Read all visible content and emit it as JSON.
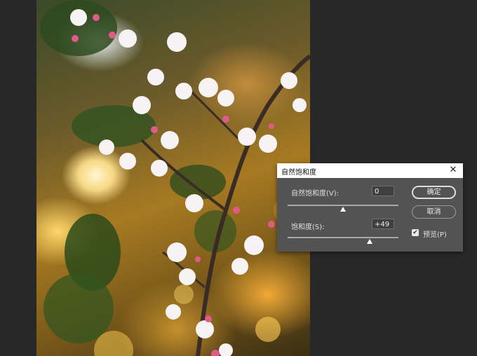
{
  "dialog": {
    "title": "自然饱和度",
    "close_glyph": "✕",
    "vibrance": {
      "label": "自然饱和度(V):",
      "value": "0",
      "slider_fraction": 0.5
    },
    "saturation": {
      "label": "饱和度(S):",
      "value": "+49",
      "slider_fraction": 0.74
    },
    "ok_label": "确定",
    "cancel_label": "取消",
    "preview": {
      "label": "预览(P)",
      "checked": true,
      "check_glyph": "✔"
    }
  },
  "colors": {
    "workspace_bg": "#282828",
    "dialog_bg": "#535353",
    "titlebar_bg": "#ffffff"
  }
}
